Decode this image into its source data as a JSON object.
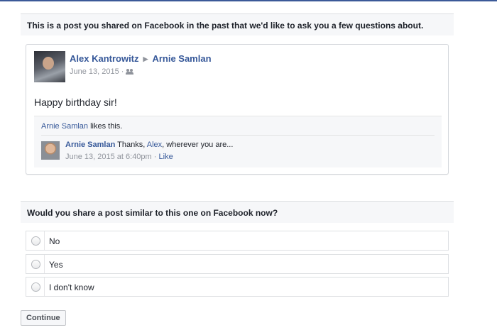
{
  "intro": {
    "header": "This is a post you shared on Facebook in the past that we'd like to ask you a few questions about."
  },
  "post": {
    "author": "Alex Kantrowitz",
    "recipient": "Arnie Samlan",
    "date": "June 13, 2015",
    "separator": "·",
    "text": "Happy birthday sir!",
    "likes": {
      "name": "Arnie Samlan",
      "suffix": " likes this."
    },
    "comment": {
      "author": "Arnie Samlan",
      "text_before": " Thanks, ",
      "mention": "Alex",
      "text_after": ", wherever you are...",
      "timestamp": "June 13, 2015 at 6:40pm",
      "separator": "·",
      "like_label": "Like"
    }
  },
  "question": {
    "header": "Would you share a post similar to this one on Facebook now?",
    "options": [
      {
        "label": "No"
      },
      {
        "label": "Yes"
      },
      {
        "label": "I don't know"
      }
    ]
  },
  "continue_label": "Continue",
  "colors": {
    "brand": "#3b5998",
    "link": "#365899",
    "muted": "#90949c",
    "panel_bg": "#f6f7f9"
  }
}
